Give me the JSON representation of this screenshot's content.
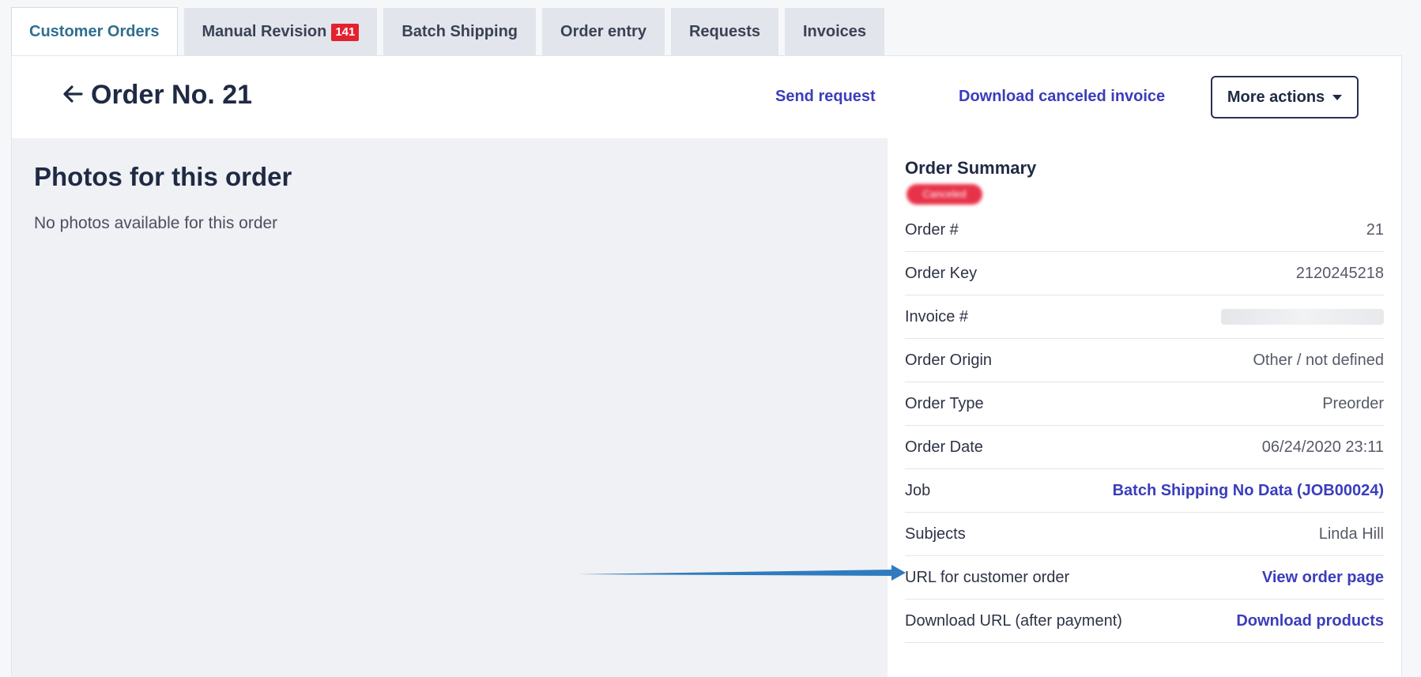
{
  "tabs": [
    {
      "label": "Customer Orders",
      "active": true
    },
    {
      "label": "Manual Revision",
      "badge": "141"
    },
    {
      "label": "Batch Shipping"
    },
    {
      "label": "Order entry"
    },
    {
      "label": "Requests"
    },
    {
      "label": "Invoices"
    }
  ],
  "header": {
    "title": "Order No. 21",
    "send_request": "Send request",
    "download_canceled_invoice": "Download canceled invoice",
    "more_actions": "More actions"
  },
  "photos": {
    "title": "Photos for this order",
    "empty_text": "No photos available for this order"
  },
  "summary": {
    "title": "Order Summary",
    "status": "Canceled",
    "rows": [
      {
        "label": "Order #",
        "value": "21"
      },
      {
        "label": "Order Key",
        "value": "2120245218"
      },
      {
        "label": "Invoice #",
        "value": ""
      },
      {
        "label": "Order Origin",
        "value": "Other / not defined"
      },
      {
        "label": "Order Type",
        "value": "Preorder"
      },
      {
        "label": "Order Date",
        "value": "06/24/2020 23:11"
      },
      {
        "label": "Job",
        "value": "Batch Shipping No Data (JOB00024)"
      },
      {
        "label": "Subjects",
        "value": "Linda Hill"
      },
      {
        "label": "URL for customer order",
        "value": "View order page"
      },
      {
        "label": "Download URL (after payment)",
        "value": "Download products"
      }
    ]
  },
  "colors": {
    "accent": "#3a3dbc",
    "badge": "#e3222f",
    "active_tab_text": "#2f6f90",
    "annotation_arrow": "#2f7bbf"
  }
}
